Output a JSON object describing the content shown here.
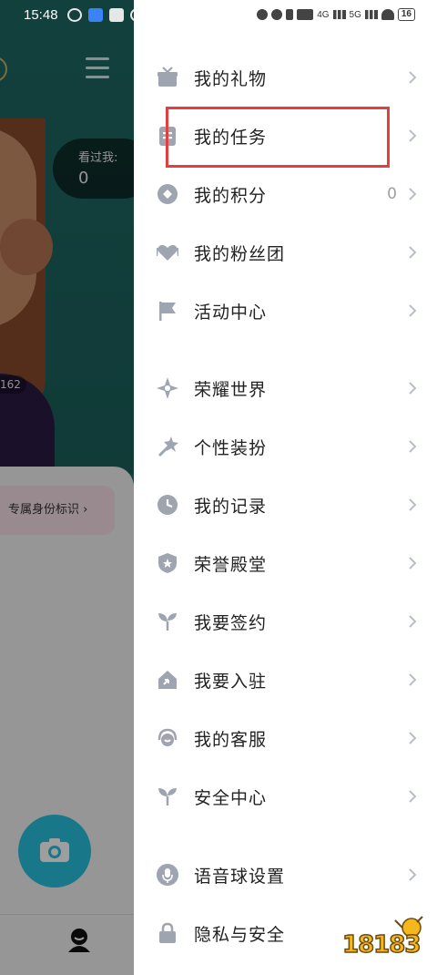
{
  "status_bar": {
    "time": "15:48",
    "network": "4G",
    "network2": "5G",
    "battery": "16"
  },
  "background_app": {
    "visit_label": "看过我:",
    "visit_count": "0",
    "photo_count": "162",
    "badge_label": "专属身份标识"
  },
  "drawer": {
    "items": [
      {
        "label": "我的礼物",
        "icon": "gift-icon"
      },
      {
        "label": "我的任务",
        "icon": "task-icon"
      },
      {
        "label": "我的积分",
        "icon": "points-icon",
        "value": "0"
      },
      {
        "label": "我的粉丝团",
        "icon": "fan-club-icon"
      },
      {
        "label": "活动中心",
        "icon": "flag-icon"
      },
      {
        "label": "荣耀世界",
        "icon": "star-compass-icon"
      },
      {
        "label": "个性装扮",
        "icon": "magic-wand-icon"
      },
      {
        "label": "我的记录",
        "icon": "clock-icon"
      },
      {
        "label": "荣誉殿堂",
        "icon": "shield-star-icon"
      },
      {
        "label": "我要签约",
        "icon": "sprout-icon"
      },
      {
        "label": "我要入驻",
        "icon": "house-arrow-icon"
      },
      {
        "label": "我的客服",
        "icon": "headset-icon"
      },
      {
        "label": "安全中心",
        "icon": "sprout-icon"
      },
      {
        "label": "语音球设置",
        "icon": "microphone-icon"
      },
      {
        "label": "隐私与安全",
        "icon": "lock-icon"
      }
    ]
  },
  "watermark": {
    "text": "18183"
  },
  "colors": {
    "icon": "#9ea4b0",
    "highlight": "#e53e3e",
    "fab": "#27c2de"
  }
}
